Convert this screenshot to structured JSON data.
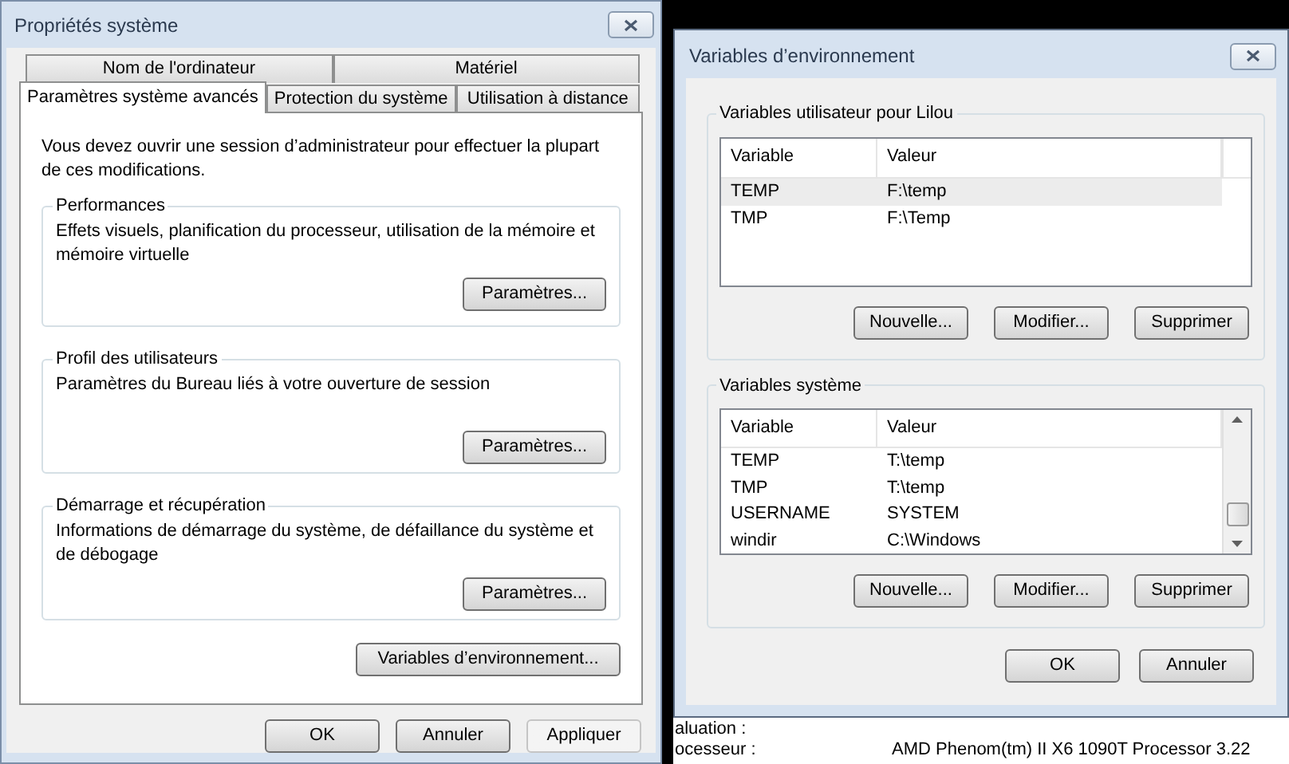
{
  "system_properties": {
    "title": "Propriétés système",
    "tabs_back": [
      {
        "label": "Nom de l'ordinateur",
        "selected": false
      },
      {
        "label": "Matériel",
        "selected": false
      }
    ],
    "tabs_front": [
      {
        "label": "Paramètres système avancés",
        "selected": true
      },
      {
        "label": "Protection du système",
        "selected": false
      },
      {
        "label": "Utilisation à distance",
        "selected": false
      }
    ],
    "notice": "Vous devez ouvrir une session d’administrateur pour effectuer la plupart de ces modifications.",
    "groups": [
      {
        "title": "Performances",
        "description": "Effets visuels, planification du processeur, utilisation de la mémoire et mémoire virtuelle",
        "button": "Paramètres..."
      },
      {
        "title": "Profil des utilisateurs",
        "description": "Paramètres du Bureau liés à votre ouverture de session",
        "button": "Paramètres..."
      },
      {
        "title": "Démarrage et récupération",
        "description": "Informations de démarrage du système, de défaillance du système et de débogage",
        "button": "Paramètres..."
      }
    ],
    "env_button": "Variables d’environnement...",
    "buttons": [
      {
        "label": "OK",
        "disabled": false
      },
      {
        "label": "Annuler",
        "disabled": false
      },
      {
        "label": "Appliquer",
        "disabled": true
      }
    ]
  },
  "environment_variables": {
    "title": "Variables d’environnement",
    "groups": [
      {
        "title": "Variables utilisateur pour Lilou",
        "columns": [
          "Variable",
          "Valeur"
        ],
        "scrollbar": false,
        "rows": [
          {
            "name": "TEMP",
            "value": "F:\\temp",
            "selected": true
          },
          {
            "name": "TMP",
            "value": "F:\\Temp",
            "selected": false
          }
        ],
        "buttons": [
          "Nouvelle...",
          "Modifier...",
          "Supprimer"
        ]
      },
      {
        "title": "Variables système",
        "columns": [
          "Variable",
          "Valeur"
        ],
        "scrollbar": true,
        "rows": [
          {
            "name": "TEMP",
            "value": "T:\\temp",
            "selected": false
          },
          {
            "name": "TMP",
            "value": "T:\\temp",
            "selected": false
          },
          {
            "name": "USERNAME",
            "value": "SYSTEM",
            "selected": false
          },
          {
            "name": "windir",
            "value": "C:\\Windows",
            "selected": false
          }
        ],
        "buttons": [
          "Nouvelle...",
          "Modifier...",
          "Supprimer"
        ]
      }
    ],
    "buttons": [
      "OK",
      "Annuler"
    ]
  },
  "background_page": {
    "lines": [
      {
        "label": "aluation :"
      },
      {
        "label": "ocesseur :",
        "value": "AMD Phenom(tm) II X6 1090T Processor   3.22"
      }
    ]
  }
}
